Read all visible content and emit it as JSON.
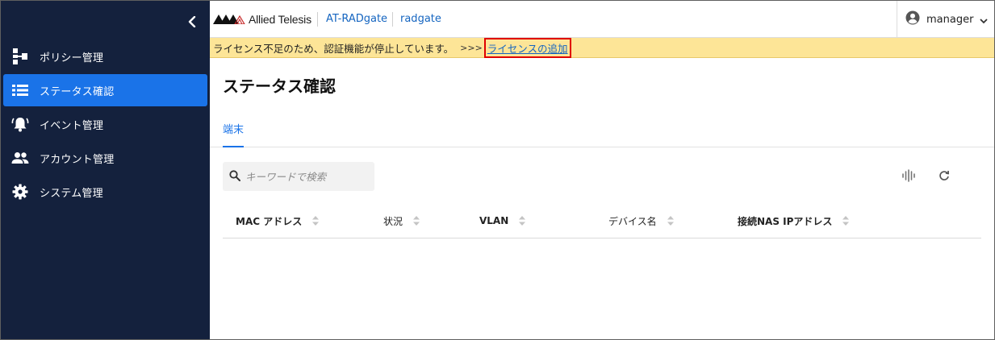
{
  "colors": {
    "sidebar_bg": "#14213d",
    "accent": "#1a73e8",
    "banner_bg": "#fde597",
    "highlight": "#e00000"
  },
  "sidebar": {
    "collapse_icon": "chevron-left-icon",
    "items": [
      {
        "label": "ポリシー管理",
        "icon": "policy-tree-icon",
        "active": false
      },
      {
        "label": "ステータス確認",
        "icon": "list-icon",
        "active": true
      },
      {
        "label": "イベント管理",
        "icon": "bell-icon",
        "active": false
      },
      {
        "label": "アカウント管理",
        "icon": "people-icon",
        "active": false
      },
      {
        "label": "システム管理",
        "icon": "gear-icon",
        "active": false
      }
    ]
  },
  "header": {
    "brand": "Allied Telesis",
    "breadcrumb": [
      "AT-RADgate",
      "radgate"
    ],
    "user": "manager"
  },
  "banner": {
    "message": "ライセンス不足のため、認証機能が停止しています。",
    "arrows": ">>>",
    "link": "ライセンスの追加"
  },
  "page": {
    "title": "ステータス確認",
    "tabs": [
      {
        "label": "端末",
        "active": true
      }
    ],
    "search": {
      "placeholder": "キーワードで検索",
      "value": ""
    },
    "table": {
      "columns": [
        "MAC アドレス",
        "状況",
        "VLAN",
        "デバイス名",
        "接続NAS IPアドレス"
      ],
      "rows": []
    }
  }
}
